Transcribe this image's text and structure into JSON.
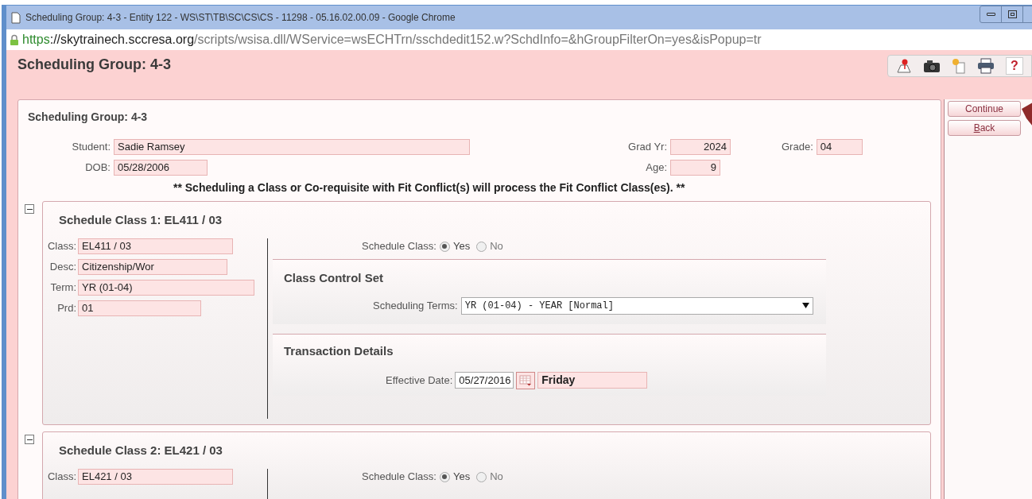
{
  "browser": {
    "title": "Scheduling Group: 4-3 - Entity 122 - WS\\ST\\TB\\SC\\CS\\CS - 11298 - 05.16.02.00.09 - Google Chrome",
    "url_scheme": "https",
    "url_host": "://skytrainech.sccresa.org",
    "url_path": "/scripts/wsisa.dll/WService=wsECHTrn/sschdedit152.w?SchdInfo=&hGroupFilterOn=yes&isPopup=tr"
  },
  "header": {
    "title": "Scheduling Group: 4-3",
    "help": "?"
  },
  "group": {
    "title": "Scheduling Group: 4-3",
    "student": {
      "label": "Student:",
      "value": "Sadie Ramsey"
    },
    "dob": {
      "label": "DOB:",
      "value": "05/28/2006"
    },
    "grad_yr": {
      "label": "Grad Yr:",
      "value": "2024"
    },
    "age": {
      "label": "Age:",
      "value": "9"
    },
    "grade": {
      "label": "Grade:",
      "value": "04"
    },
    "notice": "** Scheduling a Class or Co-requisite with Fit Conflict(s) will process the Fit Conflict Class(es). **"
  },
  "classes": [
    {
      "title": "Schedule Class 1: EL411 / 03",
      "expanded": true,
      "fields": [
        {
          "label": "Class:",
          "value": "EL411 / 03"
        },
        {
          "label": "Desc:",
          "value": "Citizenship/Wor"
        },
        {
          "label": "Term:",
          "value": "YR  (01-04)"
        },
        {
          "label": "Prd:",
          "value": "01"
        }
      ],
      "schedule_class": {
        "label": "Schedule Class:",
        "options": [
          {
            "label": "Yes",
            "selected": true
          },
          {
            "label": "No",
            "selected": false
          }
        ]
      },
      "control_set": {
        "title": "Class Control Set",
        "terms_label": "Scheduling Terms:",
        "terms_value": "YR (01-04) - YEAR [Normal]"
      },
      "transaction": {
        "title": "Transaction Details",
        "date_label": "Effective Date:",
        "date_value": "05/27/2016",
        "day": "Friday"
      }
    },
    {
      "title": "Schedule Class 2: EL421 / 03",
      "expanded": true,
      "fields": [
        {
          "label": "Class:",
          "value": "EL421 / 03"
        }
      ],
      "schedule_class": {
        "label": "Schedule Class:",
        "options": [
          {
            "label": "Yes",
            "selected": true
          },
          {
            "label": "No",
            "selected": false
          }
        ]
      }
    }
  ],
  "buttons": [
    {
      "label": "Continue",
      "underline_first": false
    },
    {
      "label": "Back",
      "underline_first": true
    }
  ]
}
